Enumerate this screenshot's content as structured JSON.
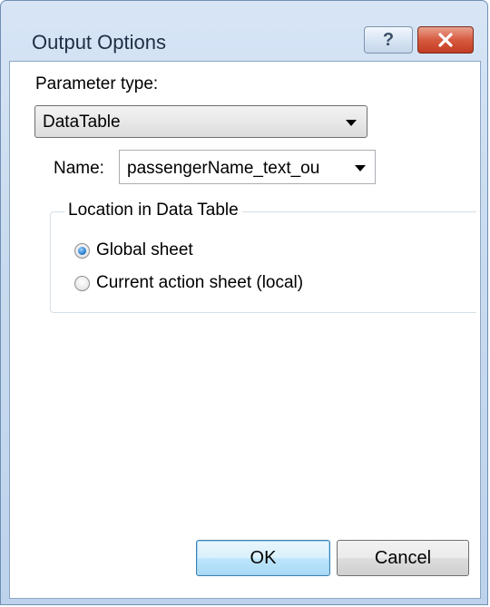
{
  "window": {
    "title": "Output Options",
    "help_glyph": "?",
    "close_glyph": "✕"
  },
  "form": {
    "parameter_type_label": "Parameter type:",
    "parameter_type_value": "DataTable",
    "name_label": "Name:",
    "name_value": "passengerName_text_ou"
  },
  "location_group": {
    "legend": "Location in Data Table",
    "options": [
      {
        "label": "Global sheet",
        "checked": true
      },
      {
        "label": "Current action sheet (local)",
        "checked": false
      }
    ]
  },
  "buttons": {
    "ok_label": "OK",
    "cancel_label": "Cancel"
  },
  "colors": {
    "title_frame": "#c9dbef",
    "close_button": "#d75a40",
    "radio_selected": "#2a7fd0",
    "default_button": "#bee6fd"
  }
}
